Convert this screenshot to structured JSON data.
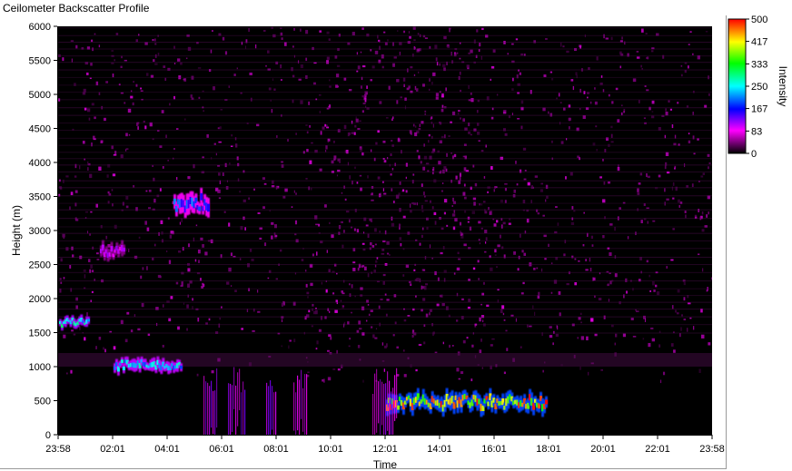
{
  "window": {
    "title": "Ceilometer Backscatter Profile"
  },
  "chart_data": {
    "type": "heatmap",
    "xlabel": "Time",
    "ylabel": "Height (m)",
    "x_tick_labels": [
      "23:58",
      "02:01",
      "04:01",
      "06:01",
      "08:01",
      "10:01",
      "12:01",
      "14:01",
      "16:01",
      "18:01",
      "20:01",
      "22:01",
      "23:58"
    ],
    "x_range_hours": [
      -0.033,
      23.967
    ],
    "y_ticks": [
      0,
      500,
      1000,
      1500,
      2000,
      2500,
      3000,
      3500,
      4000,
      4500,
      5000,
      5500,
      6000
    ],
    "ylim": [
      0,
      6000
    ],
    "colorbar": {
      "label": "Intensity",
      "tick_labels": [
        "500",
        "417",
        "333",
        "250",
        "167",
        "83",
        "0"
      ],
      "range": [
        0,
        500
      ],
      "colors": [
        "#000000",
        "#ff00ff",
        "#0000ff",
        "#00ffff",
        "#00ff00",
        "#ffff00",
        "#ff0000"
      ]
    },
    "grid": false,
    "features": [
      {
        "desc": "strong layer",
        "hours": [
          0.0,
          1.1
        ],
        "height_m": [
          1550,
          1750
        ],
        "intensity": 250
      },
      {
        "desc": "layer",
        "hours": [
          1.5,
          2.4
        ],
        "height_m": [
          2550,
          2850
        ],
        "intensity": 100
      },
      {
        "desc": "layer",
        "hours": [
          4.2,
          5.5
        ],
        "height_m": [
          3200,
          3600
        ],
        "intensity": 180
      },
      {
        "desc": "boundary layer",
        "hours": [
          2.0,
          4.5
        ],
        "height_m": [
          900,
          1150
        ],
        "intensity": 230
      },
      {
        "desc": "low cloud band",
        "hours": [
          12.0,
          17.9
        ],
        "height_m": [
          300,
          650
        ],
        "intensity": 420
      }
    ]
  }
}
